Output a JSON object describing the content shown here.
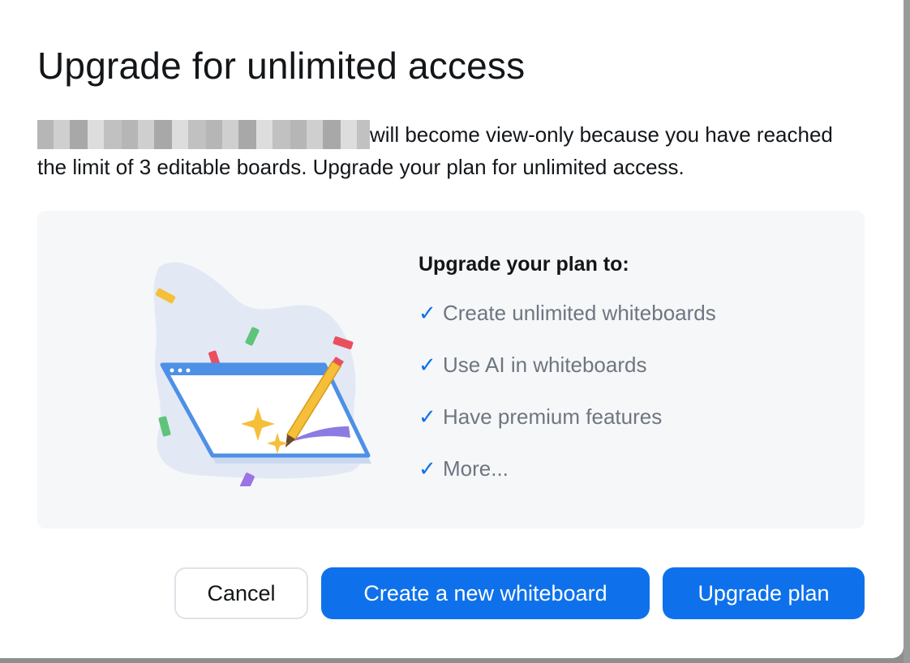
{
  "dialog": {
    "title": "Upgrade for unlimited access",
    "description": "will become view-only because you have reached the limit of 3 editable boards. Upgrade your plan for unlimited access."
  },
  "features": {
    "heading": "Upgrade your plan to:",
    "check_icon": "checkmark-icon",
    "items": [
      "Create unlimited whiteboards",
      "Use AI in whiteboards",
      "Have premium features",
      "More..."
    ]
  },
  "buttons": {
    "cancel": "Cancel",
    "create": "Create a new whiteboard",
    "upgrade": "Upgrade plan"
  },
  "colors": {
    "primary": "#0e71eb",
    "text": "#131619",
    "muted_text": "#6e7680",
    "panel_bg": "#f6f7f9"
  }
}
